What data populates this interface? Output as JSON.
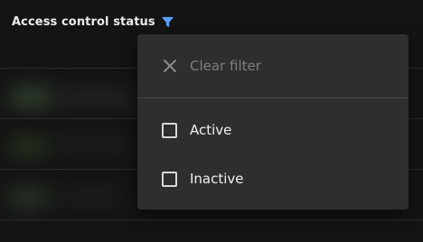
{
  "column_header": {
    "title": "Access control status",
    "filter_icon": "filter-icon",
    "filter_icon_color": "#5aa0ff"
  },
  "filter_menu": {
    "clear": {
      "label": "Clear filter",
      "icon": "close-icon",
      "disabled": true
    },
    "options": [
      {
        "label": "Active",
        "checked": false
      },
      {
        "label": "Inactive",
        "checked": false
      }
    ]
  },
  "colors": {
    "background": "#141414",
    "menu_background": "#2e2e2e",
    "accent": "#5aa0ff"
  }
}
